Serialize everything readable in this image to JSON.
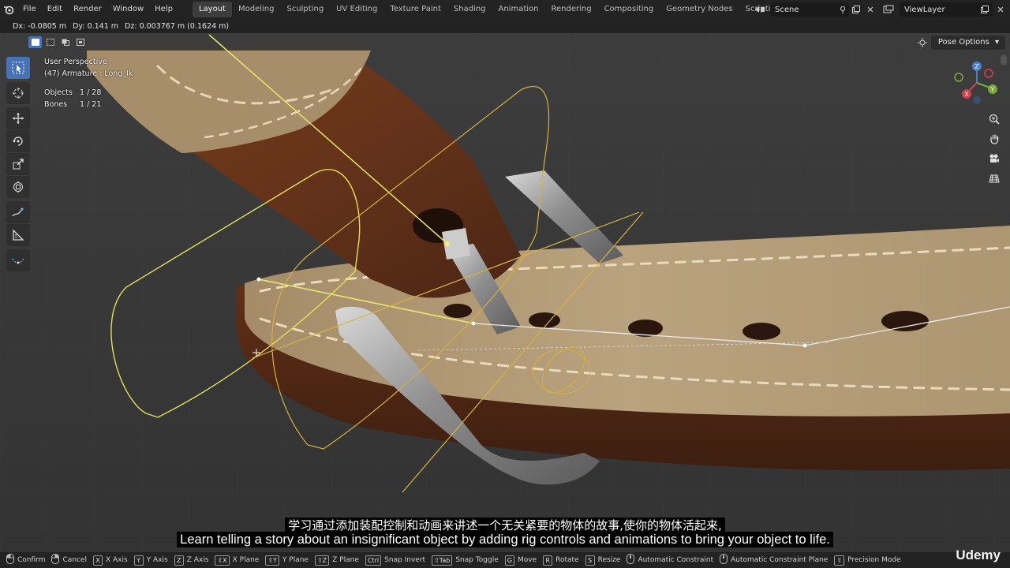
{
  "app": {
    "menus": [
      "File",
      "Edit",
      "Render",
      "Window",
      "Help"
    ],
    "workspaces": [
      "Layout",
      "Modeling",
      "Sculpting",
      "UV Editing",
      "Texture Paint",
      "Shading",
      "Animation",
      "Rendering",
      "Compositing",
      "Geometry Nodes",
      "Scripting"
    ],
    "active_workspace": "Layout",
    "add_workspace": "+",
    "scene": "Scene",
    "view_layer": "ViewLayer"
  },
  "viewport": {
    "delta": {
      "dx": "Dx: -0.0805 m",
      "dy": "Dy: 0.141 m",
      "dz": "Dz: 0.003767 m (0.1624 m)"
    },
    "perspective": "User Perspective",
    "active": "(47) Armature : Long_Ik",
    "stats": {
      "objects_label": "Objects",
      "objects_value": "1 / 28",
      "bones_label": "Bones",
      "bones_value": "1 / 21"
    },
    "pose_options": "Pose Options",
    "close_x": "X",
    "gizmo": {
      "z": "Z",
      "y": "Y",
      "x": "X"
    }
  },
  "subtitles": {
    "cn": "学习通过添加装配控制和动画来讲述一个无关紧要的物体的故事,使你的物体活起来,",
    "en": "Learn telling a story about an insignificant object by adding rig controls and animations to bring your object to life."
  },
  "statusbar": [
    {
      "key": "",
      "label": "Confirm",
      "icon": "mouse-left-icon"
    },
    {
      "key": "",
      "label": "Cancel",
      "icon": "mouse-right-icon"
    },
    {
      "key": "X",
      "label": "X Axis"
    },
    {
      "key": "Y",
      "label": "Y Axis"
    },
    {
      "key": "Z",
      "label": "Z Axis"
    },
    {
      "key": "⇧X",
      "label": "X Plane"
    },
    {
      "key": "⇧Y",
      "label": "Y Plane"
    },
    {
      "key": "⇧Z",
      "label": "Z Plane"
    },
    {
      "key": "Ctrl",
      "label": "Snap Invert"
    },
    {
      "key": "⇧Tab",
      "label": "Snap Toggle"
    },
    {
      "key": "G",
      "label": "Move"
    },
    {
      "key": "R",
      "label": "Rotate"
    },
    {
      "key": "S",
      "label": "Resize"
    },
    {
      "key": "",
      "label": "Automatic Constraint",
      "icon": "mouse-middle-icon"
    },
    {
      "key": "",
      "label": "Automatic Constraint Plane",
      "icon": "mouse-middle-icon"
    },
    {
      "key": "⇧",
      "label": "Precision Mode"
    }
  ],
  "watermark": "Udemy",
  "colors": {
    "leather_dark": "#6a3418",
    "leather_light": "#b59e78",
    "metal": "#9a9a9a",
    "bone_yellow": "#dede58",
    "accent_blue": "#4772b3"
  }
}
